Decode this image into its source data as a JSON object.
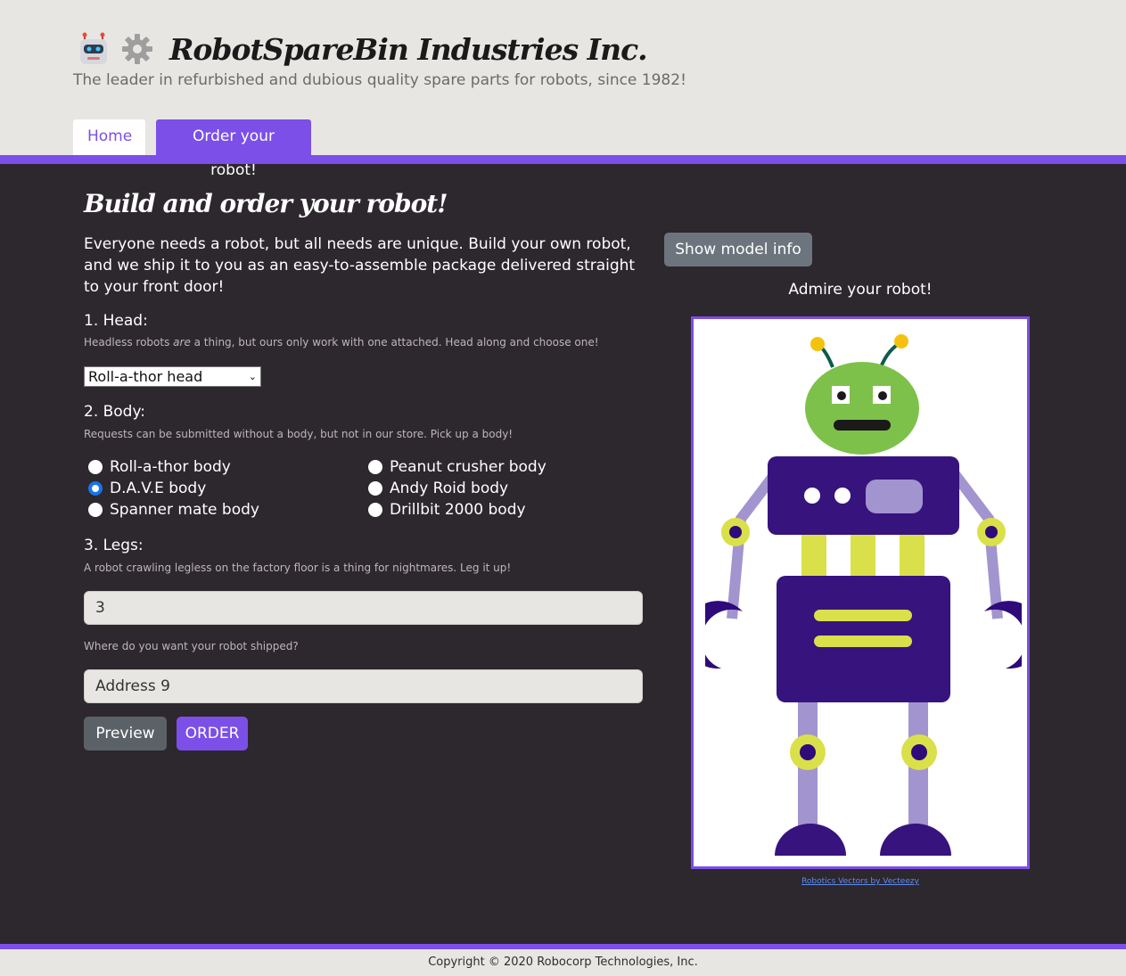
{
  "header": {
    "title": "RobotSpareBin Industries Inc.",
    "tagline": "The leader in refurbished and dubious quality spare parts for robots, since 1982!",
    "icons": [
      "robot-face-icon",
      "gear-icon"
    ]
  },
  "nav": {
    "tabs": [
      {
        "label": "Home",
        "active": false
      },
      {
        "label": "Order your robot!",
        "active": true
      }
    ]
  },
  "main": {
    "title": "Build and order your robot!",
    "intro": "Everyone needs a robot, but all needs are unique. Build your own robot, and we ship it to you as an easy-to-assemble package delivered straight to your front door!",
    "head": {
      "label": "1. Head:",
      "hint_before": "Headless robots ",
      "hint_em": "are",
      "hint_after": " a thing, but ours only work with one attached. Head along and choose one!",
      "selected": "Roll-a-thor head"
    },
    "body": {
      "label": "2. Body:",
      "hint": "Requests can be submitted without a body, but not in our store. Pick up a body!",
      "options": [
        {
          "label": "Roll-a-thor body",
          "checked": false
        },
        {
          "label": "D.A.V.E body",
          "checked": true
        },
        {
          "label": "Spanner mate body",
          "checked": false
        },
        {
          "label": "Peanut crusher body",
          "checked": false
        },
        {
          "label": "Andy Roid body",
          "checked": false
        },
        {
          "label": "Drillbit 2000 body",
          "checked": false
        }
      ]
    },
    "legs": {
      "label": "3. Legs:",
      "hint": "A robot crawling legless on the factory floor is a thing for nightmares. Leg it up!",
      "value": "3"
    },
    "address": {
      "hint": "Where do you want your robot shipped?",
      "value": "Address 9"
    },
    "buttons": {
      "preview": "Preview",
      "order": "ORDER"
    }
  },
  "preview": {
    "show_model_info": "Show model info",
    "caption": "Admire your robot!",
    "credit": "Robotics Vectors by Vecteezy"
  },
  "footer": {
    "copyright": "Copyright © 2020 Robocorp Technologies, Inc."
  },
  "colors": {
    "accent": "#7b4fe8",
    "dark_bg": "#2d272e",
    "light_bg": "#e8e6e3"
  }
}
